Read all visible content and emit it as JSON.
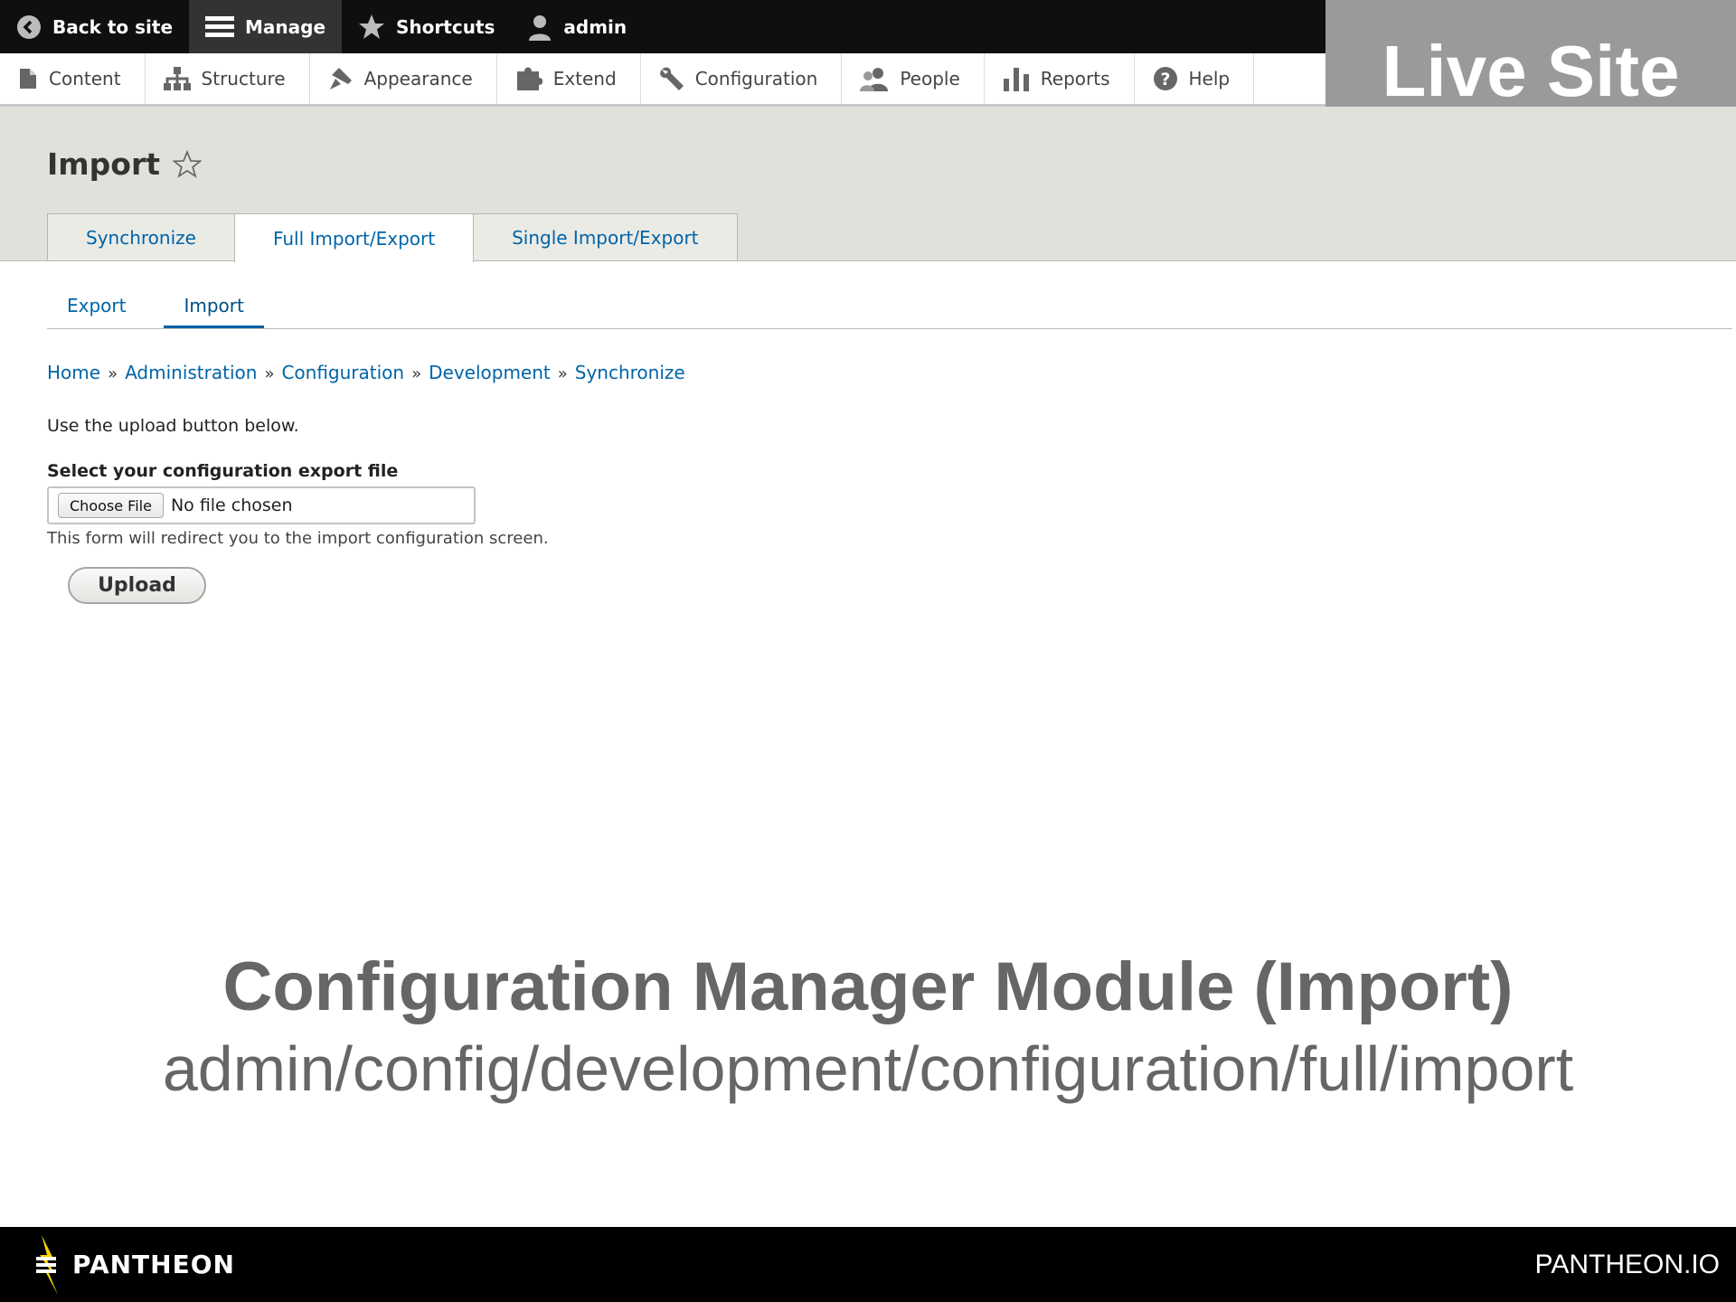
{
  "toolbar": {
    "back": "Back to site",
    "manage": "Manage",
    "shortcuts": "Shortcuts",
    "user": "admin"
  },
  "tray": [
    {
      "label": "Content",
      "icon": "page-icon"
    },
    {
      "label": "Structure",
      "icon": "structure-icon"
    },
    {
      "label": "Appearance",
      "icon": "brush-icon"
    },
    {
      "label": "Extend",
      "icon": "puzzle-icon"
    },
    {
      "label": "Configuration",
      "icon": "wrench-icon"
    },
    {
      "label": "People",
      "icon": "people-icon"
    },
    {
      "label": "Reports",
      "icon": "bar-chart-icon"
    },
    {
      "label": "Help",
      "icon": "help-icon"
    }
  ],
  "page": {
    "title": "Import"
  },
  "primary_tabs": [
    "Synchronize",
    "Full Import/Export",
    "Single Import/Export"
  ],
  "secondary_tabs": [
    "Export",
    "Import"
  ],
  "breadcrumb": [
    "Home",
    "Administration",
    "Configuration",
    "Development",
    "Synchronize"
  ],
  "breadcrumb_sep": "»",
  "content": {
    "description": "Use the upload button below.",
    "field_label": "Select your configuration export file",
    "choose_file": "Choose File",
    "no_file": "No file chosen",
    "help_text": "This form will redirect you to the import configuration screen.",
    "upload": "Upload"
  },
  "badge": {
    "live": "Live Site"
  },
  "caption": {
    "title": "Configuration Manager Module (Import)",
    "path": "admin/config/development/configuration/full/import"
  },
  "footer": {
    "brand": "PANTHEON",
    "url": "PANTHEON.IO"
  },
  "colors": {
    "link": "#0064a8",
    "toolbar": "#0f0f0f",
    "header_bg": "#e1e1db",
    "badge_bg": "#9a9a9a",
    "caption": "#666666",
    "brand_bolt": "#f5d300"
  }
}
